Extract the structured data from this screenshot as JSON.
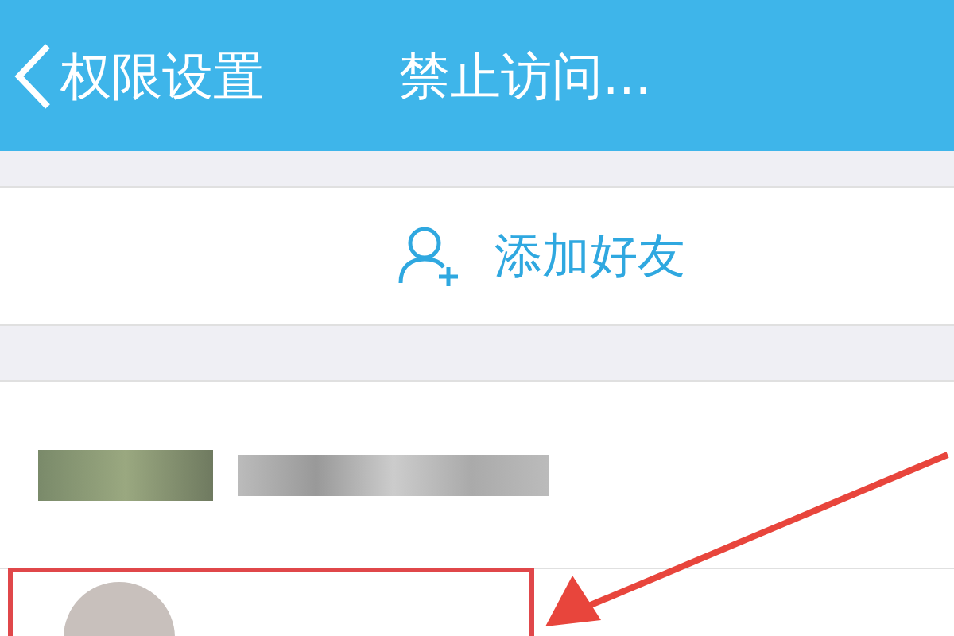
{
  "header": {
    "back_label": "权限设置",
    "title": "禁止访问..."
  },
  "add_friend": {
    "label": "添加好友"
  }
}
